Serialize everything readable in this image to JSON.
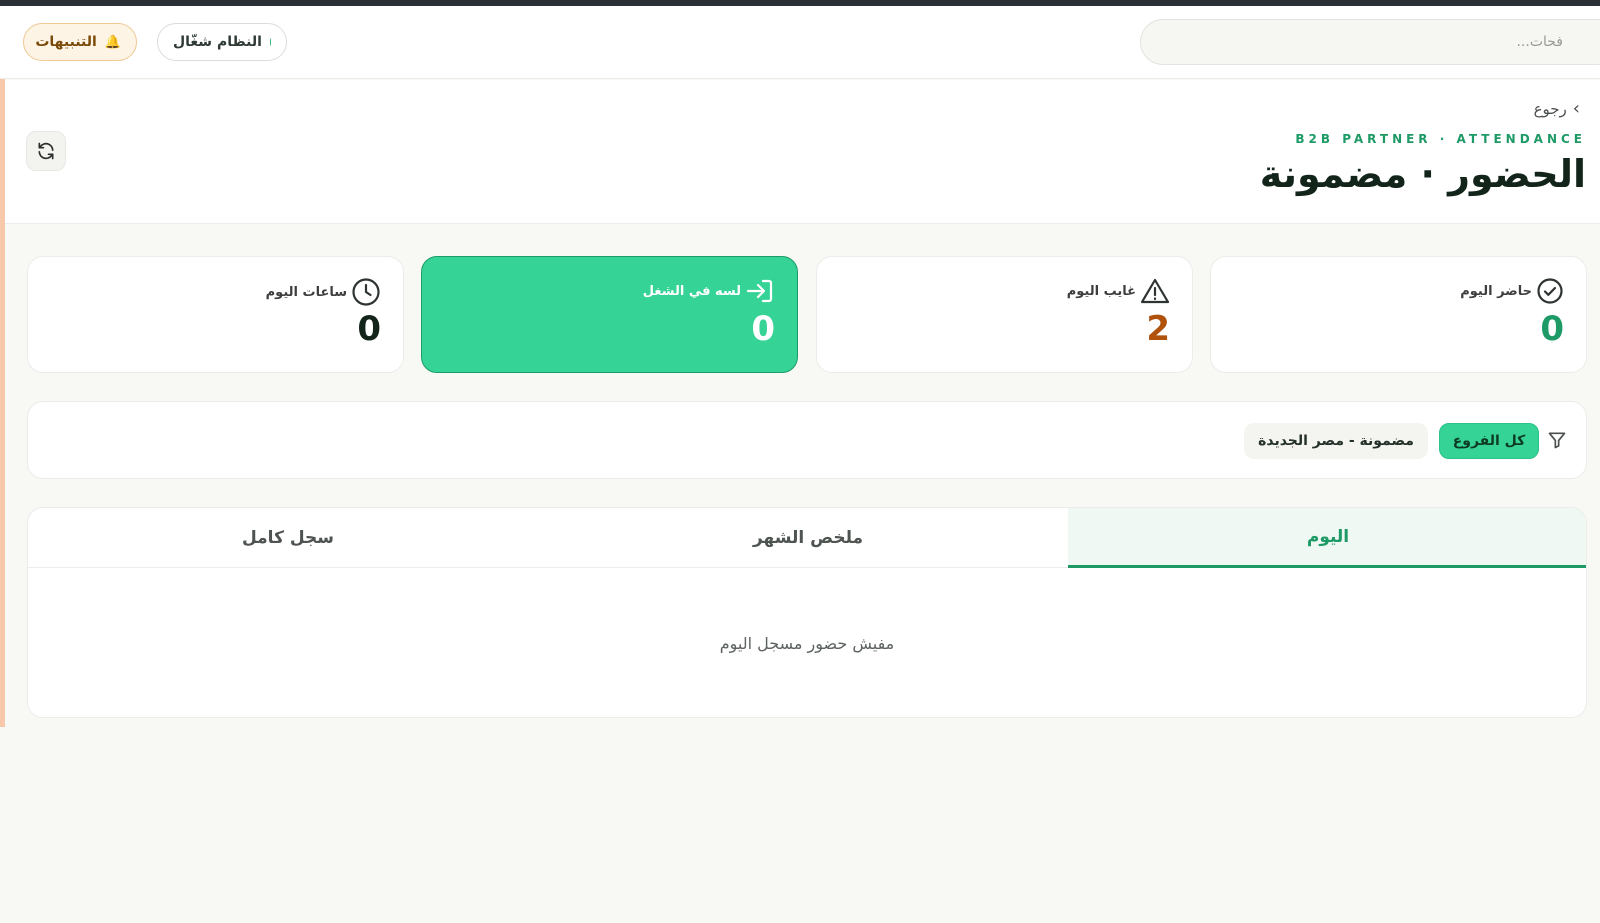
{
  "header": {
    "alerts_label": "التنبيهات",
    "system_status_label": "النظام شغّال",
    "search_placeholder": "فحات..."
  },
  "page": {
    "back_label": "رجوع",
    "eyebrow": "B2B PARTNER · ATTENDANCE",
    "title": "الحضور · مضمونة"
  },
  "stats": [
    {
      "label": "حاضر اليوم",
      "value": "0",
      "icon": "check-circle-icon",
      "color": "#1d9a66"
    },
    {
      "label": "غايب اليوم",
      "value": "2",
      "icon": "warning-triangle-icon",
      "color": "#b0520b"
    },
    {
      "label": "لسه في الشغل",
      "value": "0",
      "icon": "sign-in-icon",
      "color": "#ffffff",
      "active": true
    },
    {
      "label": "ساعات اليوم",
      "value": "0",
      "icon": "clock-icon",
      "color": "#13251b"
    }
  ],
  "filters": {
    "all_branches_label": "كل الفروع",
    "branch_label": "مضمونة - مصر الجديدة"
  },
  "tabs": [
    {
      "label": "اليوم",
      "active": true
    },
    {
      "label": "ملخص الشهر"
    },
    {
      "label": "سجل كامل"
    }
  ],
  "empty_message": "مفيش حضور مسجل اليوم",
  "colors": {
    "accent": "#36d397",
    "accent_dark": "#1d9a66",
    "warning": "#b0520b"
  }
}
